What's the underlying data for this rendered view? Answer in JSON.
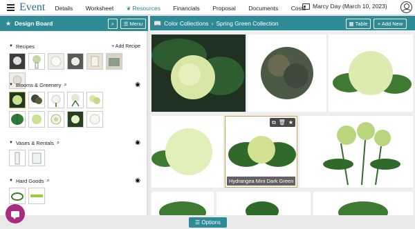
{
  "app": {
    "brand": "Event"
  },
  "nav": {
    "items": [
      "Details",
      "Worksheet",
      "Resources",
      "Financials",
      "Proposal",
      "Documents",
      "Costs"
    ],
    "active": "Resources"
  },
  "client": {
    "label": "Marcy Day (March 10, 2023)"
  },
  "left": {
    "title": "Design Board",
    "menu_label": "Menu",
    "sections": [
      {
        "name": "Recipes",
        "action": "+ Add Recipe"
      },
      {
        "name": "Blooms & Greenery"
      },
      {
        "name": "Vases & Rentals"
      },
      {
        "name": "Hard Goods"
      }
    ]
  },
  "right": {
    "breadcrumb_root": "Color Collections",
    "breadcrumb_current": "Spring Green Collection",
    "table_label": "Table",
    "add_new_label": "+ Add New",
    "selected_caption": "Hydrangea Mini Dark Green"
  },
  "footer": {
    "options_label": "Options"
  },
  "colors": {
    "teal": "#2e8b96",
    "brand": "#2d6f8a",
    "chat": "#a72b7e"
  }
}
